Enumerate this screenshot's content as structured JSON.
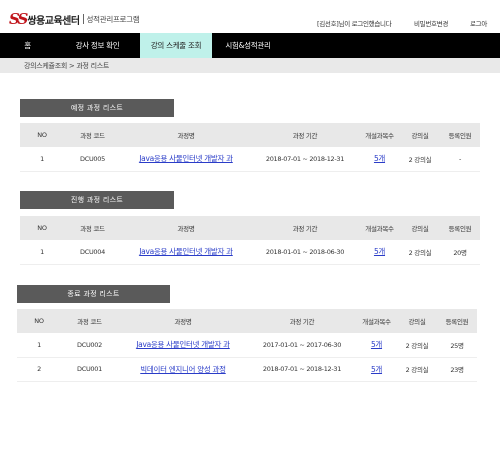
{
  "header": {
    "logo_mark": "SS",
    "logo_name": "쌍용교육센터",
    "logo_sub": "성적관리프로그램",
    "login_msg": "[김선호]님이 로그인했습니다",
    "change_pw": "비밀번호변경",
    "logout": "로그아"
  },
  "nav": {
    "items": [
      "홈",
      "강사 정보 확인",
      "강의 스케줄 조회",
      "시험&성적관리"
    ]
  },
  "breadcrumb": "강의스케쥴조회 > 과정 리스트",
  "sections": [
    {
      "title": "예정 과정 리스트",
      "headers": [
        "NO",
        "과정 코드",
        "과정명",
        "과정 기간",
        "개설과목수",
        "강의실",
        "등록인원"
      ],
      "rows": [
        {
          "no": "1",
          "code": "DCU005",
          "name": "Java응용 사물인터넷 개발자 과",
          "period": "2018-07-01 ~ 2018-12-31",
          "subjects": "5개",
          "room": "2 강의실",
          "enrolled": "-"
        }
      ]
    },
    {
      "title": "진행 과정 리스트",
      "headers": [
        "NO",
        "과정 코드",
        "과정명",
        "과정 기간",
        "개설과목수",
        "강의실",
        "등록인원"
      ],
      "rows": [
        {
          "no": "1",
          "code": "DCU004",
          "name": "Java응용 사물인터넷 개발자 과",
          "period": "2018-01-01 ~ 2018-06-30",
          "subjects": "5개",
          "room": "2 강의실",
          "enrolled": "20명"
        }
      ]
    },
    {
      "title": "종료 과정 리스트",
      "headers": [
        "NO",
        "과정 코드",
        "과정명",
        "과정 기간",
        "개설과목수",
        "강의실",
        "등록인원"
      ],
      "rows": [
        {
          "no": "1",
          "code": "DCU002",
          "name": "Java응용 사물인터넷 개발자 과",
          "period": "2017-01-01 ~ 2017-06-30",
          "subjects": "5개",
          "room": "2 강의실",
          "enrolled": "25명"
        },
        {
          "no": "2",
          "code": "DCU001",
          "name": "빅데이터 엔지니어 양성 과정",
          "period": "2018-07-01 ~ 2018-12-31",
          "subjects": "5개",
          "room": "2 강의실",
          "enrolled": "23명"
        }
      ]
    }
  ]
}
